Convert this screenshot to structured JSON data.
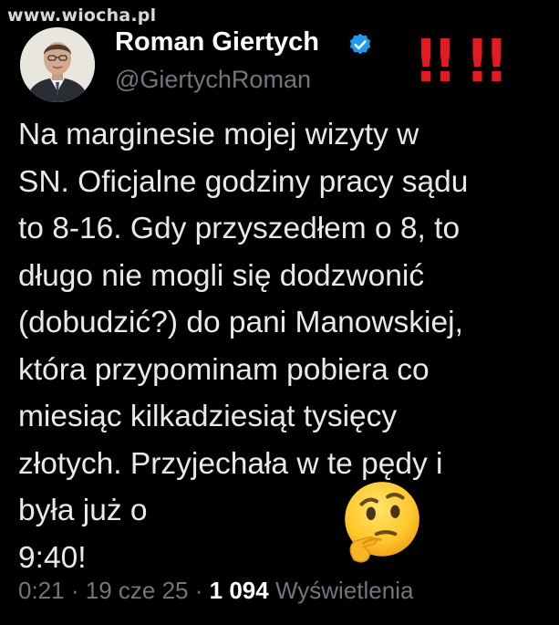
{
  "watermark": "www.wiocha.pl",
  "author": {
    "name": "Roman Giertych",
    "handle": "@GiertychRoman",
    "verified": true,
    "avatar_icon": "profile-photo"
  },
  "overlay_mark": "!! !!",
  "tweet": {
    "lines": [
      "Na marginesie mojej wizyty w",
      "SN. Oficjalne godziny pracy sądu",
      "to 8-16. Gdy przyszedłem o 8, to",
      "długo nie mogli się dodzwonić",
      "(dobudzić?) do pani Manowskiej,",
      "która przypominam pobiera co",
      "miesiąc kilkadziesiąt tysięcy",
      "złotych. Przyjechała w te pędy i",
      "była już o",
      "9:40!"
    ],
    "emoji": "thinking-face"
  },
  "meta": {
    "time": "0:21",
    "separator": "·",
    "date": "19 cze 25",
    "views_count": "1 094",
    "views_label": "Wyświetlenia"
  },
  "colors": {
    "background": "#000000",
    "text": "#e7e9ea",
    "secondary": "#71767b",
    "verified": "#1d9bf0",
    "exclamation": "#e11b22"
  }
}
